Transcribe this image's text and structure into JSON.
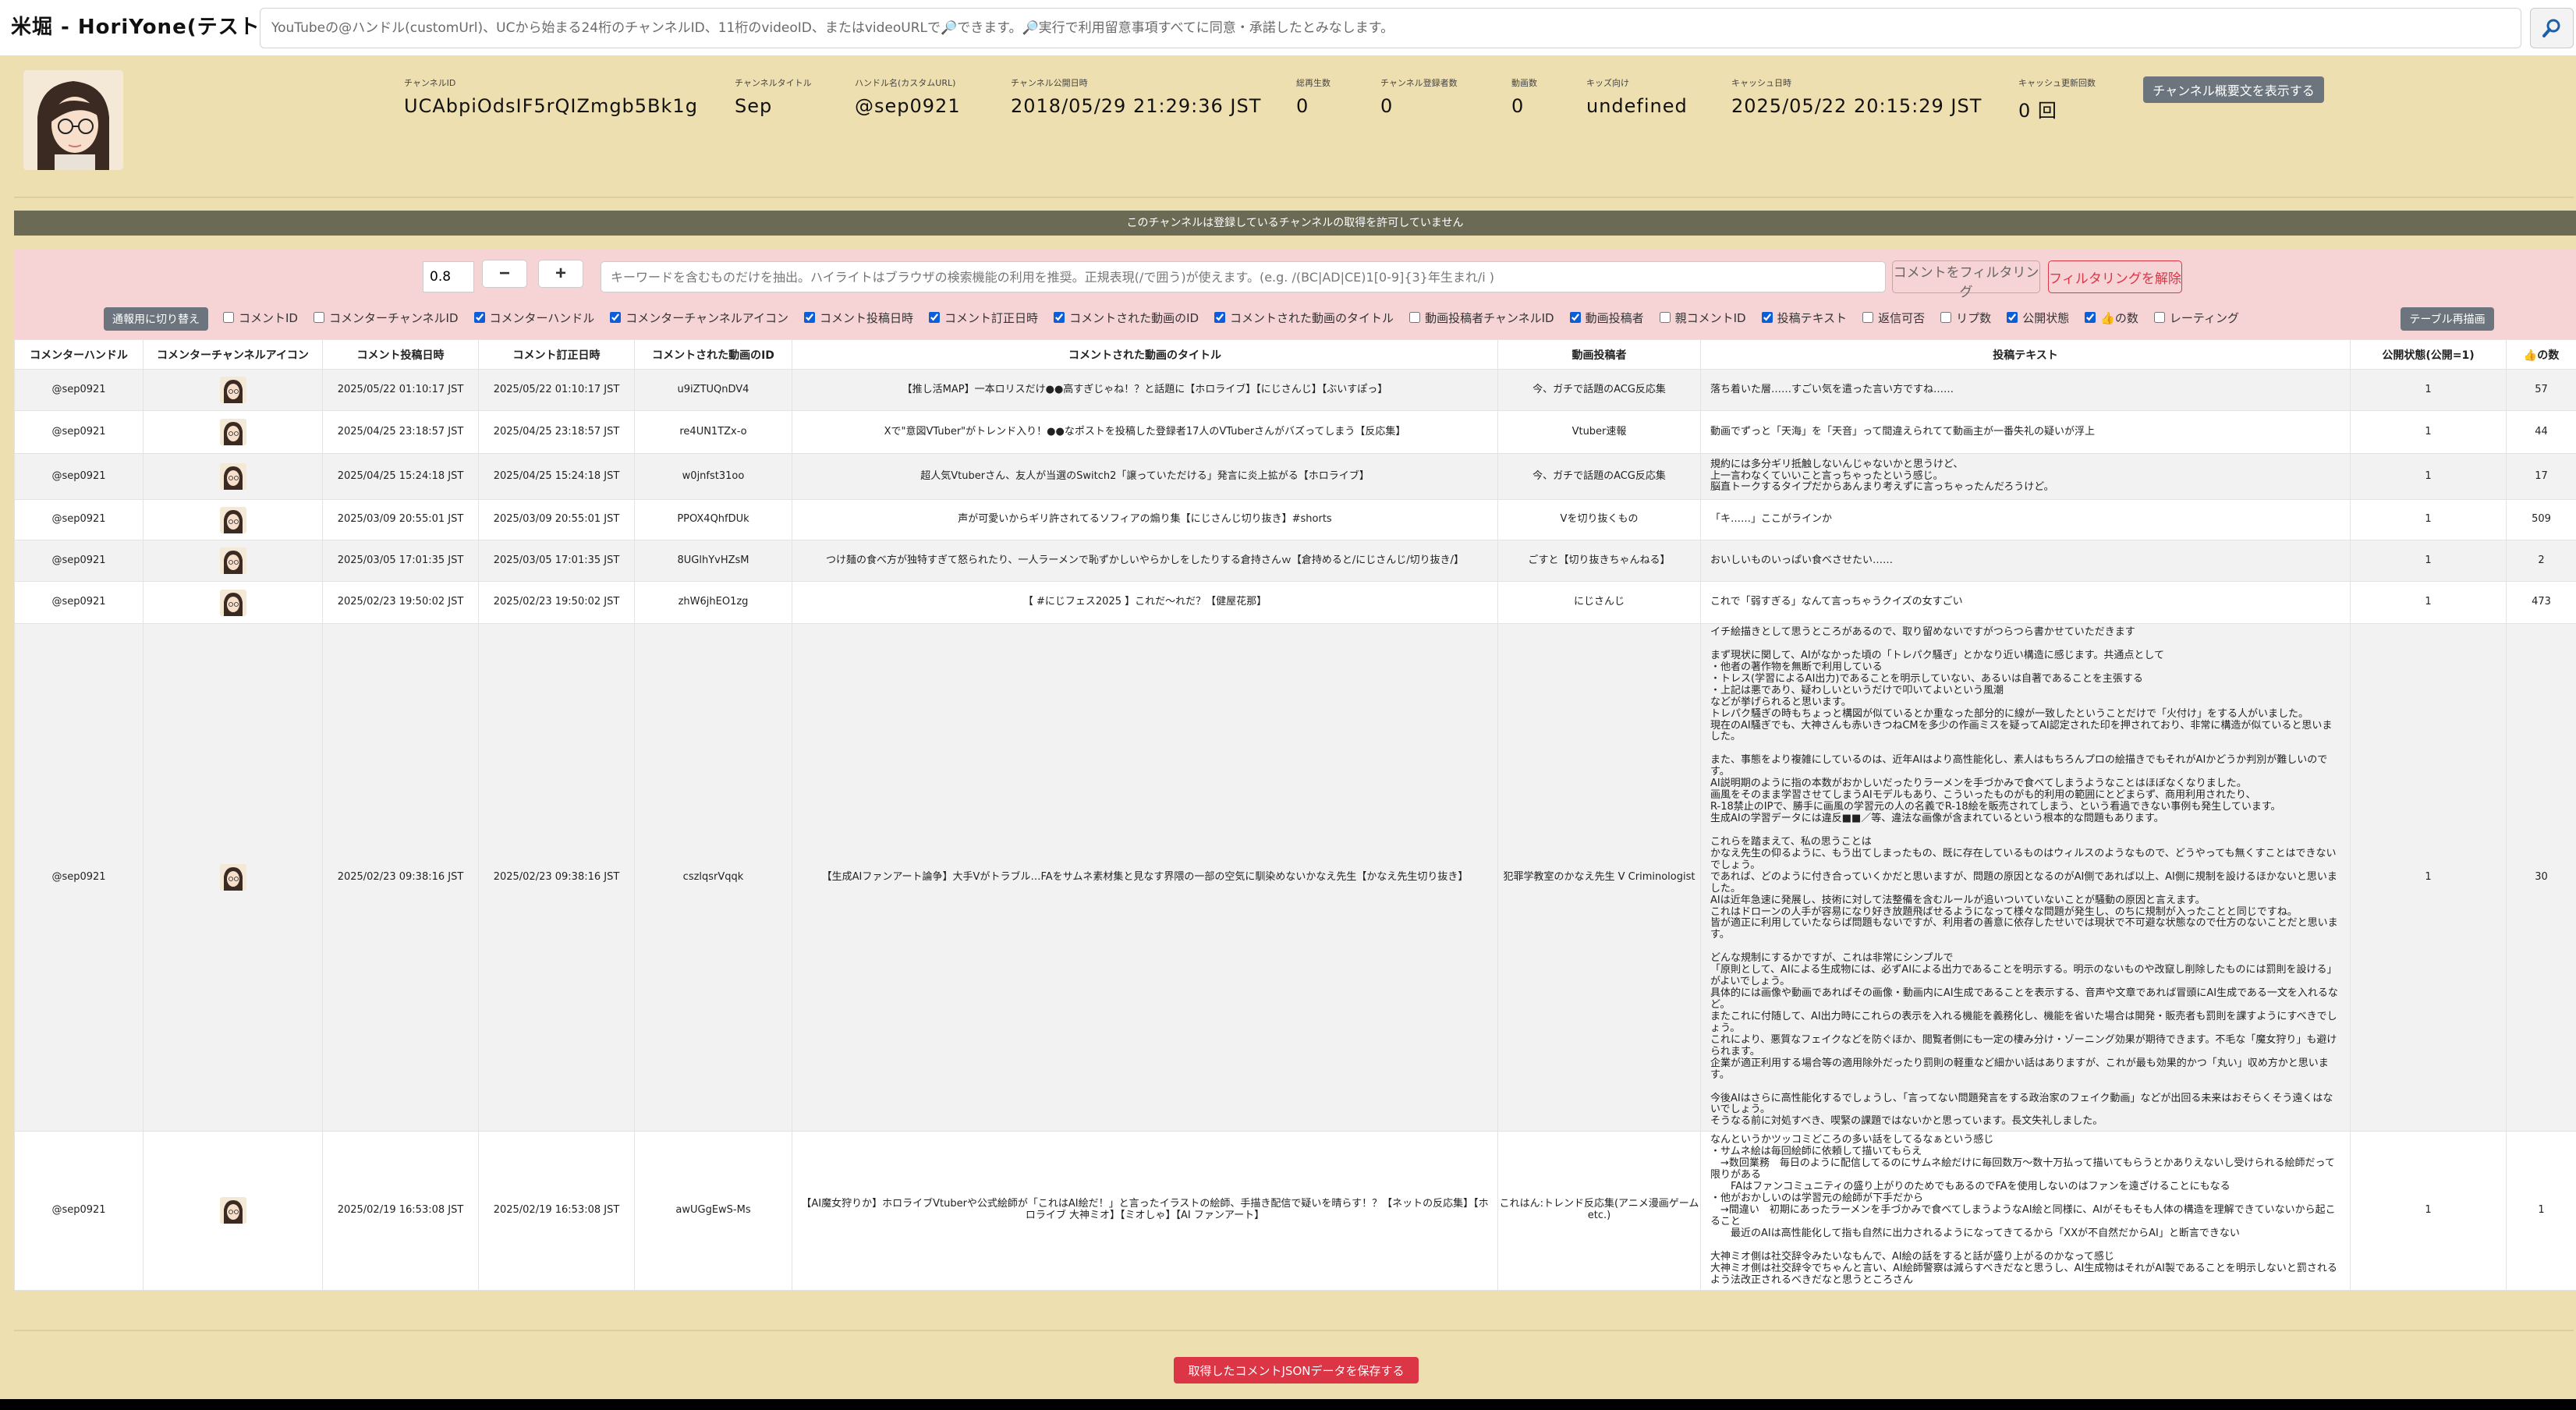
{
  "header": {
    "title": "米堀 - HoriYone(テスト中)",
    "search_placeholder": "YouTubeの@ハンドル(customUrl)、UCから始まる24桁のチャンネルID、11桁のvideoID、またはvideoURLで🔎できます。🔎実行で利用留意事項すべてに同意・承諾したとみなします。",
    "search_icon": "search-icon"
  },
  "channel": {
    "fields": [
      {
        "label": "チャンネルID",
        "value": "UCAbpiOdsIF5rQIZmgb5Bk1g"
      },
      {
        "label": "チャンネルタイトル",
        "value": "Sep"
      },
      {
        "label": "ハンドル名(カスタムURL)",
        "value": "@sep0921"
      },
      {
        "label": "チャンネル公開日時",
        "value": "2018/05/29 21:29:36 JST"
      },
      {
        "label": "総再生数",
        "value": "0"
      },
      {
        "label": "チャンネル登録者数",
        "value": "0"
      },
      {
        "label": "動画数",
        "value": "0"
      },
      {
        "label": "キッズ向け",
        "value": "undefined"
      },
      {
        "label": "キャッシュ日時",
        "value": "2025/05/22 20:15:29 JST"
      },
      {
        "label": "キャッシュ更新回数",
        "value": "0 回"
      }
    ],
    "show_description_label": "チャンネル概要文を表示する"
  },
  "banner": {
    "text": "このチャンネルは登録しているチャンネルの取得を許可していません"
  },
  "controls": {
    "zoom_value": "0.8",
    "zoom_out_label": "−",
    "zoom_in_label": "+",
    "filter_placeholder": "キーワードを含むものだけを抽出。ハイライトはブラウザの検索機能の利用を推奨。正規表現(/で囲う)が使えます。(e.g. /(BC|AD|CE)1[0-9]{3}年生まれ/i )",
    "filter_button_label": "コメントをフィルタリング",
    "clear_filter_label": "フィルタリングを解除",
    "mobile_toggle_label": "通報用に切り替え",
    "redraw_label": "テーブル再描画",
    "column_toggles": [
      {
        "label": "コメントID",
        "checked": false
      },
      {
        "label": "コメンターチャンネルID",
        "checked": false
      },
      {
        "label": "コメンターハンドル",
        "checked": true
      },
      {
        "label": "コメンターチャンネルアイコン",
        "checked": true
      },
      {
        "label": "コメント投稿日時",
        "checked": true
      },
      {
        "label": "コメント訂正日時",
        "checked": true
      },
      {
        "label": "コメントされた動画のID",
        "checked": true
      },
      {
        "label": "コメントされた動画のタイトル",
        "checked": true
      },
      {
        "label": "動画投稿者チャンネルID",
        "checked": false
      },
      {
        "label": "動画投稿者",
        "checked": true
      },
      {
        "label": "親コメントID",
        "checked": false
      },
      {
        "label": "投稿テキスト",
        "checked": true
      },
      {
        "label": "返信可否",
        "checked": false
      },
      {
        "label": "リプ数",
        "checked": false
      },
      {
        "label": "公開状態",
        "checked": true
      },
      {
        "label": "👍の数",
        "checked": true
      },
      {
        "label": "レーティング",
        "checked": false
      }
    ]
  },
  "table": {
    "columns": [
      "コメンターハンドル",
      "コメンターチャンネルアイコン",
      "コメント投稿日時",
      "コメント訂正日時",
      "コメントされた動画のID",
      "コメントされた動画のタイトル",
      "動画投稿者",
      "投稿テキスト",
      "公開状態(公開=1)",
      "👍の数"
    ],
    "rows": [
      {
        "handle": "@sep0921",
        "posted": "2025/05/22 01:10:17 JST",
        "edited": "2025/05/22 01:10:17 JST",
        "video_id": "u9iZTUQnDV4",
        "video_title": "【推し活MAP】一本ロリスだけ●●高すぎじゃね！？と話題に【ホロライブ】【にじさんじ】【ぶいすぽっ】",
        "uploader": "今、ガチで話題のACG反応集",
        "text": "落ち着いた層……すごい気を遣った言い方ですね……",
        "public": "1",
        "likes": "57"
      },
      {
        "handle": "@sep0921",
        "posted": "2025/04/25 23:18:57 JST",
        "edited": "2025/04/25 23:18:57 JST",
        "video_id": "re4UN1TZx-o",
        "video_title": "Xで\"意図VTuber\"がトレンド入り！●●なポストを投稿した登録者17人のVTuberさんがバズってしまう【反応集】",
        "uploader": "Vtuber速報",
        "text": "動画でずっと「天海」を「天音」って間違えられてて動画主が一番失礼の疑いが浮上",
        "public": "1",
        "likes": "44"
      },
      {
        "handle": "@sep0921",
        "posted": "2025/04/25 15:24:18 JST",
        "edited": "2025/04/25 15:24:18 JST",
        "video_id": "w0jnfst31oo",
        "video_title": "超人気Vtuberさん、友人が当選のSwitch2「譲っていただける」発言に炎上拡がる【ホロライブ】",
        "uploader": "今、ガチで話題のACG反応集",
        "text": "規約には多分ギリ抵触しないんじゃないかと思うけど、\n上一言わなくていいこと言っちゃったという感じ。\n脳直トークするタイプだからあんまり考えずに言っちゃったんだろうけど。",
        "public": "1",
        "likes": "17"
      },
      {
        "handle": "@sep0921",
        "posted": "2025/03/09 20:55:01 JST",
        "edited": "2025/03/09 20:55:01 JST",
        "video_id": "PPOX4QhfDUk",
        "video_title": "声が可愛いからギリ許されてるソフィアの煽り集【にじさんじ切り抜き】#shorts",
        "uploader": "Vを切り抜くもの",
        "text": "「キ……」ここがラインか",
        "public": "1",
        "likes": "509"
      },
      {
        "handle": "@sep0921",
        "posted": "2025/03/05 17:01:35 JST",
        "edited": "2025/03/05 17:01:35 JST",
        "video_id": "8UGlhYvHZsM",
        "video_title": "つけ麺の食べ方が独特すぎて怒られたり、一人ラーメンで恥ずかしいやらかしをしたりする倉持さんｗ【倉持めると/にじさんじ/切り抜き/】",
        "uploader": "ごすと【切り抜きちゃんねる】",
        "text": "おいしいものいっぱい食べさせたい……",
        "public": "1",
        "likes": "2"
      },
      {
        "handle": "@sep0921",
        "posted": "2025/02/23 19:50:02 JST",
        "edited": "2025/02/23 19:50:02 JST",
        "video_id": "zhW6jhEO1zg",
        "video_title": "【 #にじフェス2025 】これだ〜れだ？【健屋花那】",
        "uploader": "にじさんじ",
        "text": "これで「弱すぎる」なんて言っちゃうクイズの女すごい",
        "public": "1",
        "likes": "473"
      },
      {
        "handle": "@sep0921",
        "posted": "2025/02/23 09:38:16 JST",
        "edited": "2025/02/23 09:38:16 JST",
        "video_id": "cszlqsrVqqk",
        "video_title": "【生成AIファンアート論争】大手Vがトラブル…FAをサムネ素材集と見なす界隈の一部の空気に馴染めないかなえ先生【かなえ先生切り抜き】",
        "uploader": "犯罪学教室のかなえ先生 V Criminologist",
        "text": "イチ絵描きとして思うところがあるので、取り留めないですがつらつら書かせていただきます\n\nまず現状に関して、AIがなかった頃の「トレパク騒ぎ」とかなり近い構造に感じます。共通点として\n・他者の著作物を無断で利用している\n・トレス(学習によるAI出力)であることを明示していない、あるいは自著であることを主張する\n・上記は悪であり、疑わしいというだけで叩いてよいという風潮\nなどが挙げられると思います。\nトレパク騒ぎの時もちょっと構図が似ているとか重なった部分的に線が一致したということだけで「火付け」をする人がいました。\n現在のAI騒ぎでも、大神さんも赤いきつねCMを多少の作画ミスを疑ってAI認定された印を押されており、非常に構造が似ていると思いました。\n\nまた、事態をより複雑にしているのは、近年AIはより高性能化し、素人はもちろんプロの絵描きでもそれがAIかどうか判別が難しいのです。\nAI説明期のように指の本数がおかしいだったりラーメンを手づかみで食べてしまうようなことはほぼなくなりました。\n画風をそのまま学習させてしまうAIモデルもあり、こういったものがも的利用の範囲にとどまらず、商用利用されたり、\nR-18禁止のIPで、勝手に画風の学習元の人の名義でR-18絵を販売されてしまう、という看過できない事例も発生しています。\n生成AIの学習データには違反■■／等、違法な画像が含まれているという根本的な問題もあります。\n\nこれらを踏まえて、私の思うことは\nかなえ先生の仰るように、もう出てしまったもの、既に存在しているものはウィルスのようなもので、どうやっても無くすことはできないでしょう。\nであれば、どのように付き合っていくかだと思いますが、問題の原因となるのがAI側であれば以上、AI側に規制を設けるほかないと思いました。\nAIは近年急速に発展し、技術に対して法整備を含むルールが追いついていないことが騒動の原因と言えます。\nこれはドローンの人手が容易になり好き放題飛ばせるようになって様々な問題が発生し、のちに規制が入ったことと同じですね。\n皆が適正に利用していたならば問題もないですが、利用者の善意に依存したせいでは現状で不可避な状態なので仕方のないことだと思います。\n\nどんな規制にするかですが、これは非常にシンプルで\n「原則として、AIによる生成物には、必ずAIによる出力であることを明示する。明示のないものや改竄し削除したものには罰則を設ける」\nがよいでしょう。\n具体的には画像や動画であればその画像・動画内にAI生成であることを表示する、音声や文章であれば冒頭にAI生成である一文を入れるなど。\nまたこれに付随して、AI出力時にこれらの表示を入れる機能を義務化し、機能を省いた場合は開発・販売者も罰則を課すようにすべきでしょう。\nこれにより、悪質なフェイクなどを防ぐほか、閲覧者側にも一定の棲み分け・ゾーニング効果が期待できます。不毛な「魔女狩り」も避けられます。\n企業が適正利用する場合等の適用除外だったり罰則の軽重など細かい話はありますが、これが最も効果的かつ「丸い」収め方かと思います。\n\n今後AIはさらに高性能化するでしょうし、「言ってない問題発言をする政治家のフェイク動画」などが出回る未来はおそらくそう遠くはないでしょう。\nそうなる前に対処すべき、喫緊の課題ではないかと思っています。長文失礼しました。",
        "public": "1",
        "likes": "30"
      },
      {
        "handle": "@sep0921",
        "posted": "2025/02/19 16:53:08 JST",
        "edited": "2025/02/19 16:53:08 JST",
        "video_id": "awUGgEwS-Ms",
        "video_title": "【AI魔女狩りか】ホロライブVtuberや公式絵師が「これはAI絵だ！」と言ったイラストの絵師、手描き配信で疑いを晴らす！？【ネットの反応集】【ホロライブ 大神ミオ】【ミオしゃ】【AI ファンアート】",
        "uploader": "これはん:トレンド反応集(アニメ漫画ゲームetc.)",
        "text": "なんというかツッコミどころの多い話をしてるなぁという感じ\n・サムネ絵は毎回絵師に依頼して描いてもらえ\n　→数回業務　毎日のように配信してるのにサムネ絵だけに毎回数万〜数十万払って描いてもらうとかありえないし受けられる絵師だって限りがある\n　　FAはファンコミュニティの盛り上がりのためでもあるのでFAを使用しないのはファンを遠ざけることにもなる\n・他がおかしいのは学習元の絵師が下手だから\n　→間違い　初期にあったラーメンを手づかみで食べてしまうようなAI絵と同様に、AIがそもそも人体の構造を理解できていないから起こること\n　　最近のAIは高性能化して指も自然に出力されるようになってきてるから「XXが不自然だからAI」と断言できない\n\n大神ミオ側は社交辞令みたいなもんで、AI絵の話をすると話が盛り上がるのかなって感じ\n大神ミオ側は社交辞令でちゃんと言い、AI絵師警察は減らすべきだなと思うし、AI生成物はそれがAI製であることを明示しないと罰されるよう法改正されるべきだなと思うところさん",
        "public": "1",
        "likes": "1"
      }
    ]
  },
  "footer": {
    "save_json_label": "取得したコメントJSONデータを保存する"
  }
}
